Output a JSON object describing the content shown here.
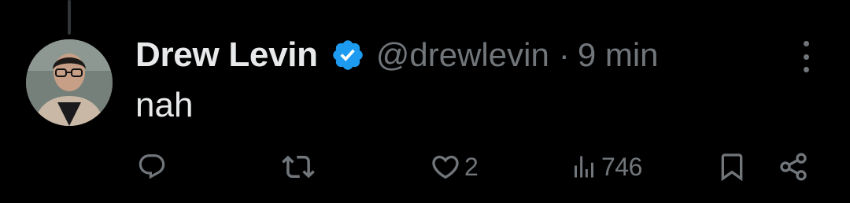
{
  "post": {
    "author": {
      "display_name": "Drew Levin",
      "handle": "@drewlevin",
      "verified": true
    },
    "separator": "·",
    "timestamp": "9 min",
    "text": "nah"
  },
  "actions": {
    "reply": {
      "icon": "reply-icon"
    },
    "repost": {
      "icon": "repost-icon"
    },
    "like": {
      "icon": "heart-icon",
      "count": "2"
    },
    "views": {
      "icon": "views-icon",
      "count": "746"
    },
    "bookmark": {
      "icon": "bookmark-icon"
    },
    "share": {
      "icon": "share-icon"
    }
  },
  "colors": {
    "background": "#000000",
    "text_primary": "#e7e9ea",
    "text_secondary": "#71767b",
    "verified_badge": "#1d9bf0"
  }
}
